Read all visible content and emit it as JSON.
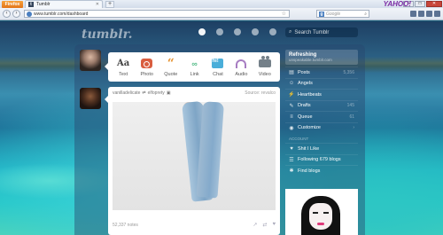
{
  "browser": {
    "app_button": "Firefox",
    "tab_title": "Tumblr",
    "url": "www.tumblr.com/dashboard",
    "search_placeholder": "Google",
    "yahoo_logo": "YAHOO!"
  },
  "header": {
    "logo": "tumblr.",
    "search_placeholder": "Search Tumblr"
  },
  "post_types": [
    {
      "label": "Text",
      "glyph": "Aa"
    },
    {
      "label": "Photo",
      "glyph": ""
    },
    {
      "label": "Quote",
      "glyph": "“"
    },
    {
      "label": "Link",
      "glyph": "∞"
    },
    {
      "label": "Chat",
      "glyph": "hi!"
    },
    {
      "label": "Audio",
      "glyph": ""
    },
    {
      "label": "Video",
      "glyph": ""
    }
  ],
  "post": {
    "author": "vanilladelicate",
    "reblog_source": "elfoprety",
    "source_label": "Source: revalco",
    "notes": "52,337 notes"
  },
  "sidebar": {
    "blog_name": "Refreshing",
    "blog_url": "unspeakable.tumblr.com",
    "items": [
      {
        "label": "Posts",
        "count": "5,356",
        "icon": "▤"
      },
      {
        "label": "Angels",
        "count": "",
        "icon": "☺"
      },
      {
        "label": "Heartbeats",
        "count": "",
        "icon": "⚡"
      },
      {
        "label": "Drafts",
        "count": "145",
        "icon": "✎"
      },
      {
        "label": "Queue",
        "count": "61",
        "icon": "≡"
      },
      {
        "label": "Customize",
        "count": "",
        "icon": "◉"
      }
    ],
    "account_label": "ACCOUNT",
    "account_items": [
      {
        "label": "Shit I Like",
        "icon": "♥"
      },
      {
        "label": "Following 679 blogs",
        "icon": "☰"
      },
      {
        "label": "Find blogs",
        "icon": "✱"
      }
    ]
  }
}
